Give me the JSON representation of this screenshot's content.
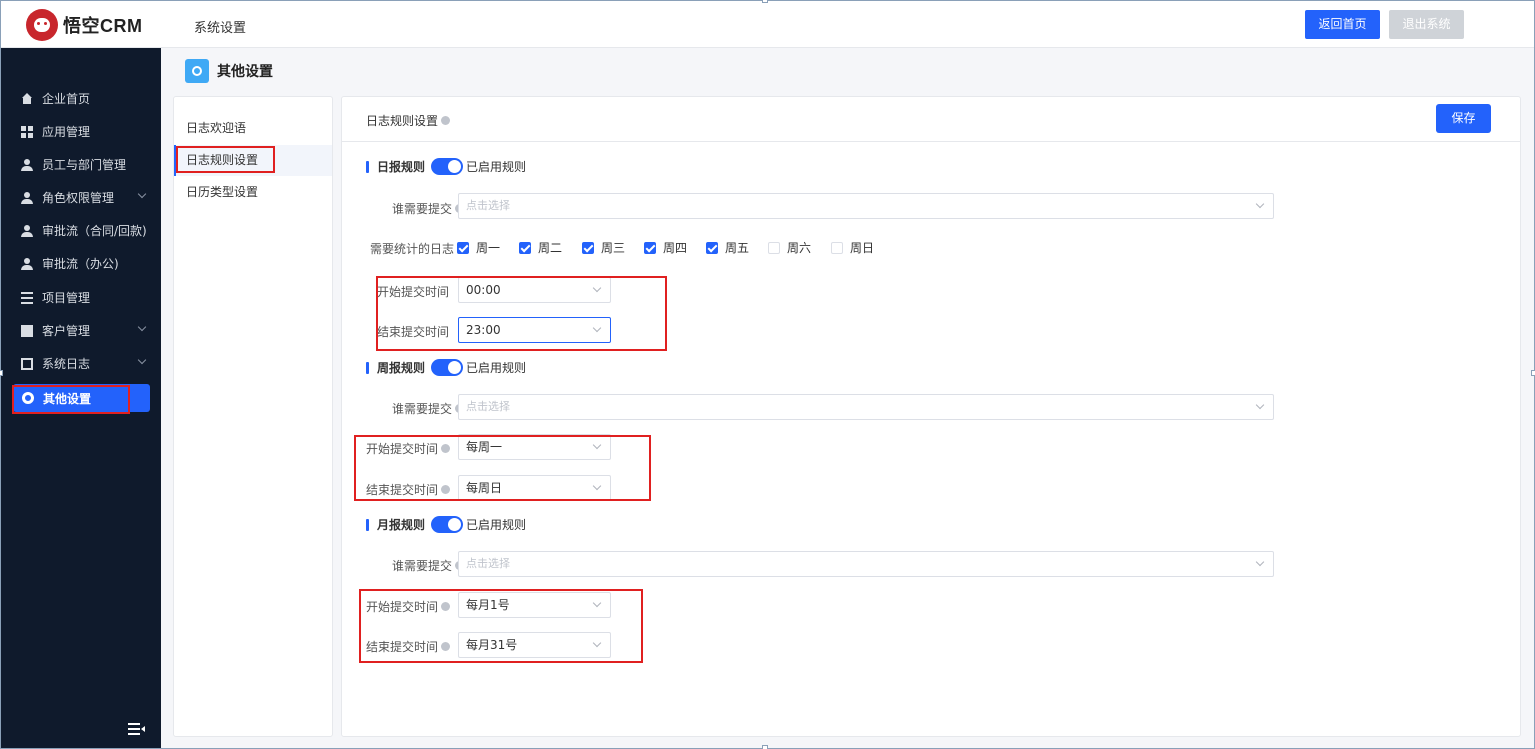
{
  "header": {
    "logo_text": "悟空CRM",
    "title": "系统设置",
    "home_button": "返回首页",
    "exit_button": "退出系统"
  },
  "sidebar": {
    "items": [
      {
        "label": "企业首页",
        "icon": "home-icon"
      },
      {
        "label": "应用管理",
        "icon": "grid-icon"
      },
      {
        "label": "员工与部门管理",
        "icon": "users-icon"
      },
      {
        "label": "角色权限管理",
        "icon": "user-icon"
      },
      {
        "label": "审批流（合同/回款)",
        "icon": "approval-icon"
      },
      {
        "label": "审批流（办公)",
        "icon": "approval-icon"
      },
      {
        "label": "项目管理",
        "icon": "list-icon"
      },
      {
        "label": "客户管理",
        "icon": "building-icon"
      },
      {
        "label": "系统日志",
        "icon": "document-icon"
      },
      {
        "label": "其他设置",
        "icon": "gear-icon"
      }
    ]
  },
  "page_title": "其他设置",
  "submenu": {
    "items": [
      "日志欢迎语",
      "日志规则设置",
      "日历类型设置"
    ],
    "active": "日志规则设置"
  },
  "main": {
    "title": "日志规则设置",
    "save_button": "保存",
    "daily": {
      "label": "日报规则",
      "toggle_text": "已启用规则",
      "who_label": "谁需要提交",
      "who_placeholder": "点击选择",
      "days_label": "需要统计的日志",
      "days": [
        {
          "label": "周一",
          "checked": true
        },
        {
          "label": "周二",
          "checked": true
        },
        {
          "label": "周三",
          "checked": true
        },
        {
          "label": "周四",
          "checked": true
        },
        {
          "label": "周五",
          "checked": true
        },
        {
          "label": "周六",
          "checked": false
        },
        {
          "label": "周日",
          "checked": false
        }
      ],
      "start_label": "开始提交时间",
      "start_value": "00:00",
      "end_label": "结束提交时间",
      "end_value": "23:00"
    },
    "weekly": {
      "label": "周报规则",
      "toggle_text": "已启用规则",
      "who_label": "谁需要提交",
      "who_placeholder": "点击选择",
      "start_label": "开始提交时间",
      "start_value": "每周一",
      "end_label": "结束提交时间",
      "end_value": "每周日"
    },
    "monthly": {
      "label": "月报规则",
      "toggle_text": "已启用规则",
      "who_label": "谁需要提交",
      "who_placeholder": "点击选择",
      "start_label": "开始提交时间",
      "start_value": "每月1号",
      "end_label": "结束提交时间",
      "end_value": "每月31号"
    }
  },
  "colors": {
    "primary": "#2362fb",
    "sidebar_bg": "#0f1a2c",
    "annotation_red": "#e02020"
  }
}
